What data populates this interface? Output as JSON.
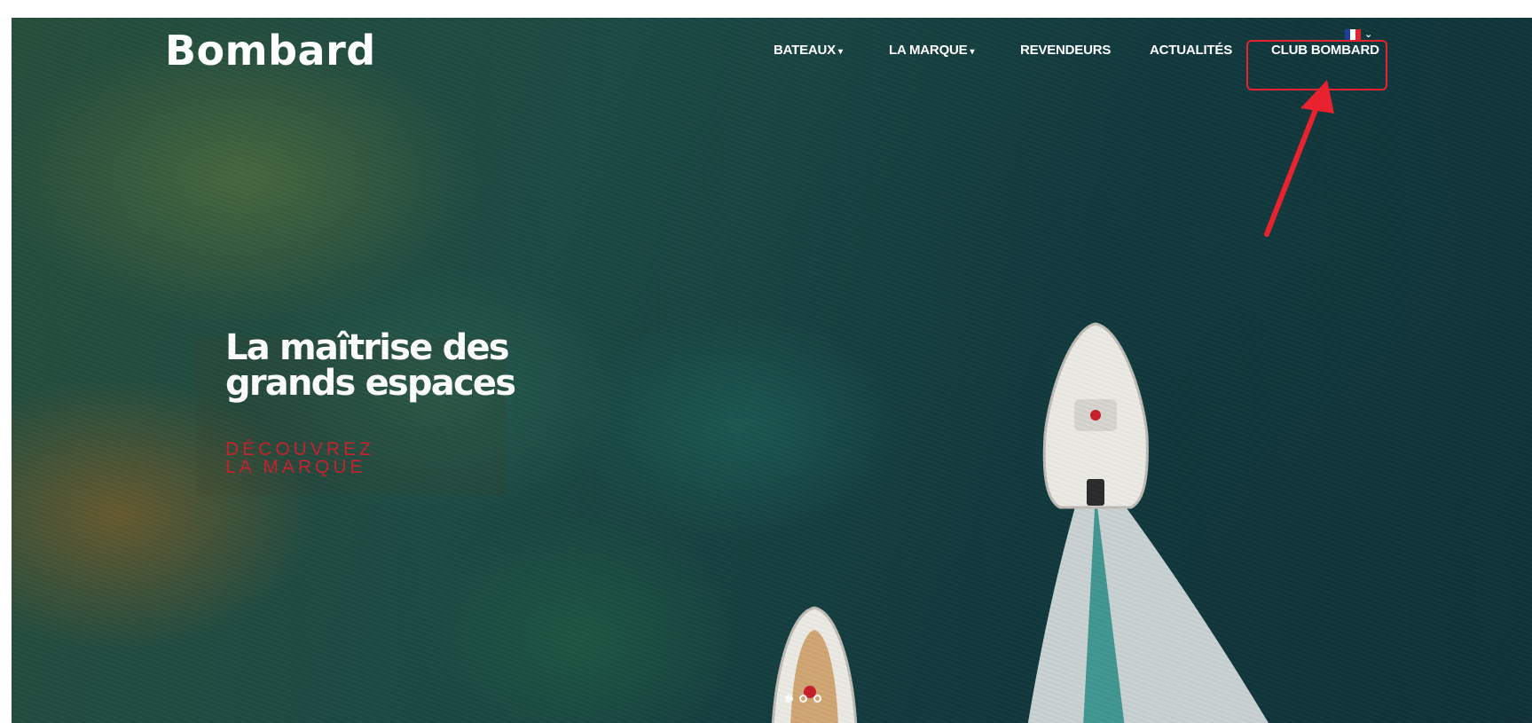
{
  "brand": {
    "logo_text": "Bombard"
  },
  "language": {
    "flag_icon": "france-flag-icon",
    "flag_colors": [
      "#1f3e97",
      "#ffffff",
      "#e1252f"
    ],
    "dropdown_icon": "chevron-down-icon"
  },
  "nav": {
    "items": [
      {
        "label": "BATEAUX",
        "has_dropdown": true,
        "caret": "▾"
      },
      {
        "label": "LA MARQUE",
        "has_dropdown": true,
        "caret": "▾"
      },
      {
        "label": "REVENDEURS",
        "has_dropdown": false
      },
      {
        "label": "ACTUALITÉS",
        "has_dropdown": false
      },
      {
        "label": "CLUB BOMBARD",
        "has_dropdown": false,
        "highlighted": true
      }
    ]
  },
  "hero": {
    "headline_line1": "La maîtrise des",
    "headline_line2": "grands espaces",
    "cta_line1": "DÉCOUVREZ",
    "cta_line2": "LA MARQUE",
    "cta_color": "#c8202c",
    "slider": {
      "count": 3,
      "active_index": 0
    }
  },
  "annotation": {
    "target": "CLUB BOMBARD",
    "color": "#e8222e",
    "shape": "box-and-arrow"
  }
}
